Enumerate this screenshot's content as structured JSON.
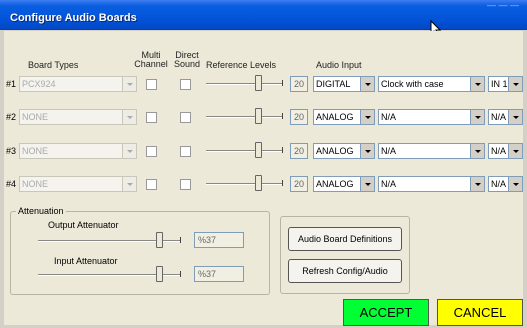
{
  "window": {
    "title": "Configure Audio Boards",
    "faint_corner_text": "— — —"
  },
  "headers": {
    "board_types": "Board Types",
    "multi_line1": "Multi",
    "multi_line2": "Channel",
    "direct_line1": "Direct",
    "direct_line2": "Sound",
    "reference_levels": "Reference Levels",
    "audio_input": "Audio Input"
  },
  "rows": [
    {
      "num": "#1",
      "board": "PCX924",
      "ref_level": "20",
      "input_type": "DIGITAL",
      "clock": "Clock with case",
      "channel": "IN 1"
    },
    {
      "num": "#2",
      "board": "NONE",
      "ref_level": "20",
      "input_type": "ANALOG",
      "clock": "N/A",
      "channel": "N/A"
    },
    {
      "num": "#3",
      "board": "NONE",
      "ref_level": "20",
      "input_type": "ANALOG",
      "clock": "N/A",
      "channel": "N/A"
    },
    {
      "num": "#4",
      "board": "NONE",
      "ref_level": "20",
      "input_type": "ANALOG",
      "clock": "N/A",
      "channel": "N/A"
    }
  ],
  "attenuation": {
    "group_label": "Attenuation",
    "output_label": "Output Attenuator",
    "output_value": "%37",
    "input_label": "Input Attenuator",
    "input_value": "%37"
  },
  "buttons": {
    "definitions": "Audio Board Definitions",
    "refresh": "Refresh Config/Audio",
    "accept": "ACCEPT",
    "cancel": "CANCEL"
  },
  "colors": {
    "title_bar": "#0252d8",
    "accept_bg": "#00ff33",
    "cancel_bg": "#ffff00"
  }
}
